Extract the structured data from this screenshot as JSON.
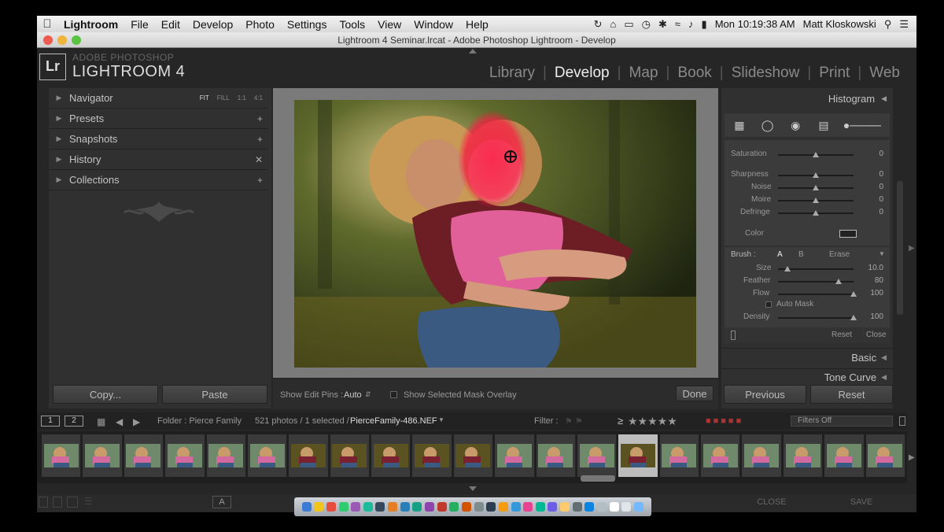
{
  "menubar": {
    "app_name": "Lightroom",
    "items": [
      "File",
      "Edit",
      "Develop",
      "Photo",
      "Settings",
      "Tools",
      "View",
      "Window",
      "Help"
    ],
    "clock": "Mon 10:19:38 AM",
    "user": "Matt Kloskowski"
  },
  "window": {
    "title": "Lightroom 4 Seminar.lrcat - Adobe Photoshop Lightroom - Develop"
  },
  "identity": {
    "logo": "Lr",
    "small": "ADOBE PHOTOSHOP",
    "big": "LIGHTROOM 4"
  },
  "modules": [
    "Library",
    "Develop",
    "Map",
    "Book",
    "Slideshow",
    "Print",
    "Web"
  ],
  "left_panel": {
    "navigator": "Navigator",
    "nav_sizes": [
      "FIT",
      "FILL",
      "1:1",
      "4:1"
    ],
    "presets": "Presets",
    "snapshots": "Snapshots",
    "history": "History",
    "collections": "Collections",
    "copy_label": "Copy...",
    "paste_label": "Paste"
  },
  "toolbar": {
    "show_edit_pins": "Show Edit Pins :",
    "pins_value": "Auto",
    "show_mask": "Show Selected Mask Overlay",
    "done": "Done"
  },
  "right_panel": {
    "histogram": "Histogram",
    "sliders": [
      {
        "label": "Saturation",
        "value": "0",
        "pos": 0.5
      },
      {
        "label": "Sharpness",
        "value": "0",
        "pos": 0.5
      },
      {
        "label": "Noise",
        "value": "0",
        "pos": 0.5
      },
      {
        "label": "Moire",
        "value": "0",
        "pos": 0.5
      },
      {
        "label": "Defringe",
        "value": "0",
        "pos": 0.5
      }
    ],
    "color_label": "Color",
    "brush_label": "Brush :",
    "brush_a": "A",
    "brush_b": "B",
    "brush_erase": "Erase",
    "brush_sliders": [
      {
        "label": "Size",
        "value": "10.0",
        "pos": 0.13
      },
      {
        "label": "Feather",
        "value": "80",
        "pos": 0.8
      },
      {
        "label": "Flow",
        "value": "100",
        "pos": 1.0
      }
    ],
    "auto_mask": "Auto Mask",
    "density": {
      "label": "Density",
      "value": "100",
      "pos": 1.0
    },
    "reset": "Reset",
    "close": "Close",
    "basic": "Basic",
    "tone_curve": "Tone Curve",
    "previous_label": "Previous",
    "reset_label": "Reset"
  },
  "filmstrip_bar": {
    "page1": "1",
    "page2": "2",
    "folder": "Folder : Pierce Family",
    "count": "521 photos / 1 selected /",
    "filename": "PierceFamily-486.NEF",
    "filter_label": "Filter :",
    "rating_op": "≥",
    "stars": "★★★★★",
    "filters_off": "Filters Off"
  },
  "filmstrip": {
    "thumb_count": 21,
    "selected_index": 14
  },
  "bottom": {
    "a_label": "A",
    "close": "CLOSE",
    "save": "SAVE"
  },
  "colors": {
    "mask_overlay": "#ff1744",
    "panel_bg": "#303030",
    "center_bg": "#7a7a7a"
  }
}
